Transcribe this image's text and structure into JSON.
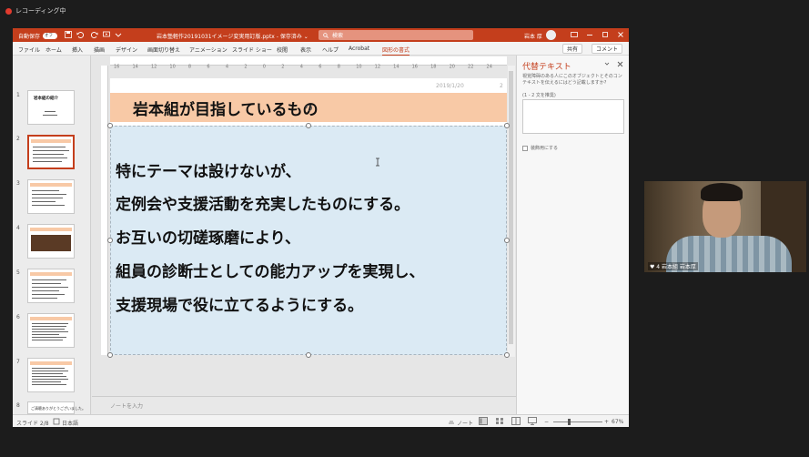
{
  "recording": {
    "label": "レコーディング中"
  },
  "titlebar": {
    "autosave_label": "自動保存",
    "autosave_state": "オフ",
    "document_title": "岩本塾軽作20191031イメージ変実用訂版.pptx - 保存済み ⌄",
    "search_placeholder": "検索",
    "user_name": "岩本 厚"
  },
  "ribbon": {
    "tabs": [
      "ファイル",
      "ホーム",
      "挿入",
      "描画",
      "デザイン",
      "画面切り替え",
      "アニメーション",
      "スライド ショー",
      "校閲",
      "表示",
      "ヘルプ",
      "Acrobat",
      "図形の書式"
    ],
    "active_tab": "図形の書式",
    "share_label": "共有",
    "comment_label": "コメント"
  },
  "thumbnails": {
    "numbers": [
      "1",
      "2",
      "3",
      "4",
      "5",
      "6",
      "7",
      "8"
    ],
    "slide1_title": "岩本組の紹介",
    "slide8_text": "ご清聴ありがとうございました。"
  },
  "ruler": {
    "marks": [
      "16",
      "14",
      "12",
      "10",
      "8",
      "6",
      "4",
      "2",
      "0",
      "2",
      "4",
      "6",
      "8",
      "10",
      "12",
      "14",
      "16",
      "18",
      "20",
      "22",
      "24"
    ]
  },
  "slide": {
    "date": "2019/1/20",
    "page_number": "2",
    "title": "岩本組が目指しているもの",
    "body_lines": [
      "特にテーマは設けないが、",
      "定例会や支援活動を充実したものにする。",
      "お互いの切磋琢磨により、",
      "組員の診断士としての能力アップを実現し、",
      "支援現場で役に立てるようにする。"
    ]
  },
  "notes": {
    "placeholder": "ノートを入力"
  },
  "alt_text_pane": {
    "title": "代替テキスト",
    "description": "視覚障碍のある人にこのオブジェクトとそのコンテキストを伝えるにはどう記載しますか?",
    "hint": "(1 - 2 文を推奨)",
    "checkbox_label": "装飾用にする"
  },
  "statusbar": {
    "slide_info": "スライド 2/8",
    "language": "日本語",
    "notes_label": "ノート",
    "zoom": "67%"
  },
  "webcam": {
    "label": "♥ 4 岩本組 岩本厚"
  },
  "colors": {
    "accent": "#c43e1c",
    "title_band": "#f8c9a6",
    "textbox_fill": "#dbeaf4"
  }
}
